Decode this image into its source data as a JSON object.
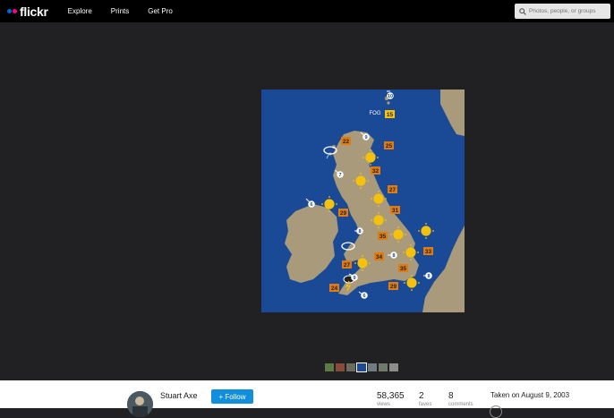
{
  "header": {
    "logo_text": "flickr",
    "nav": [
      "Explore",
      "Prints",
      "Get Pro"
    ],
    "search_placeholder": "Photos, people, or groups"
  },
  "photo": {
    "markers": [
      {
        "type": "wind",
        "value": "10"
      },
      {
        "type": "label",
        "value": "FOG"
      },
      {
        "type": "temp",
        "value": "15"
      },
      {
        "type": "wind",
        "value": "9"
      },
      {
        "type": "temp",
        "value": "22"
      },
      {
        "type": "temp",
        "value": "25"
      },
      {
        "type": "temp",
        "value": "32"
      },
      {
        "type": "wind",
        "value": "7"
      },
      {
        "type": "temp",
        "value": "27"
      },
      {
        "type": "wind",
        "value": "6"
      },
      {
        "type": "temp",
        "value": "29"
      },
      {
        "type": "temp",
        "value": "31"
      },
      {
        "type": "wind",
        "value": "8"
      },
      {
        "type": "temp",
        "value": "35"
      },
      {
        "type": "temp",
        "value": "33"
      },
      {
        "type": "wind",
        "value": "8"
      },
      {
        "type": "temp",
        "value": "34"
      },
      {
        "type": "temp",
        "value": "27"
      },
      {
        "type": "temp",
        "value": "35"
      },
      {
        "type": "wind",
        "value": "8"
      },
      {
        "type": "wind",
        "value": "9"
      },
      {
        "type": "temp",
        "value": "24"
      },
      {
        "type": "temp",
        "value": "29"
      },
      {
        "type": "wind",
        "value": "6"
      }
    ]
  },
  "owner": {
    "name": "Stuart Axe",
    "follow_label": "+ Follow"
  },
  "stats": [
    {
      "value": "58,365",
      "label": "views"
    },
    {
      "value": "2",
      "label": "faves"
    },
    {
      "value": "8",
      "label": "comments"
    }
  ],
  "taken": "Taken on August 9, 2003",
  "colors": {
    "sea": "#1a4a96",
    "land": "#a89a7a",
    "temp_badge": "#e07b12",
    "accent": "#128fdc"
  }
}
